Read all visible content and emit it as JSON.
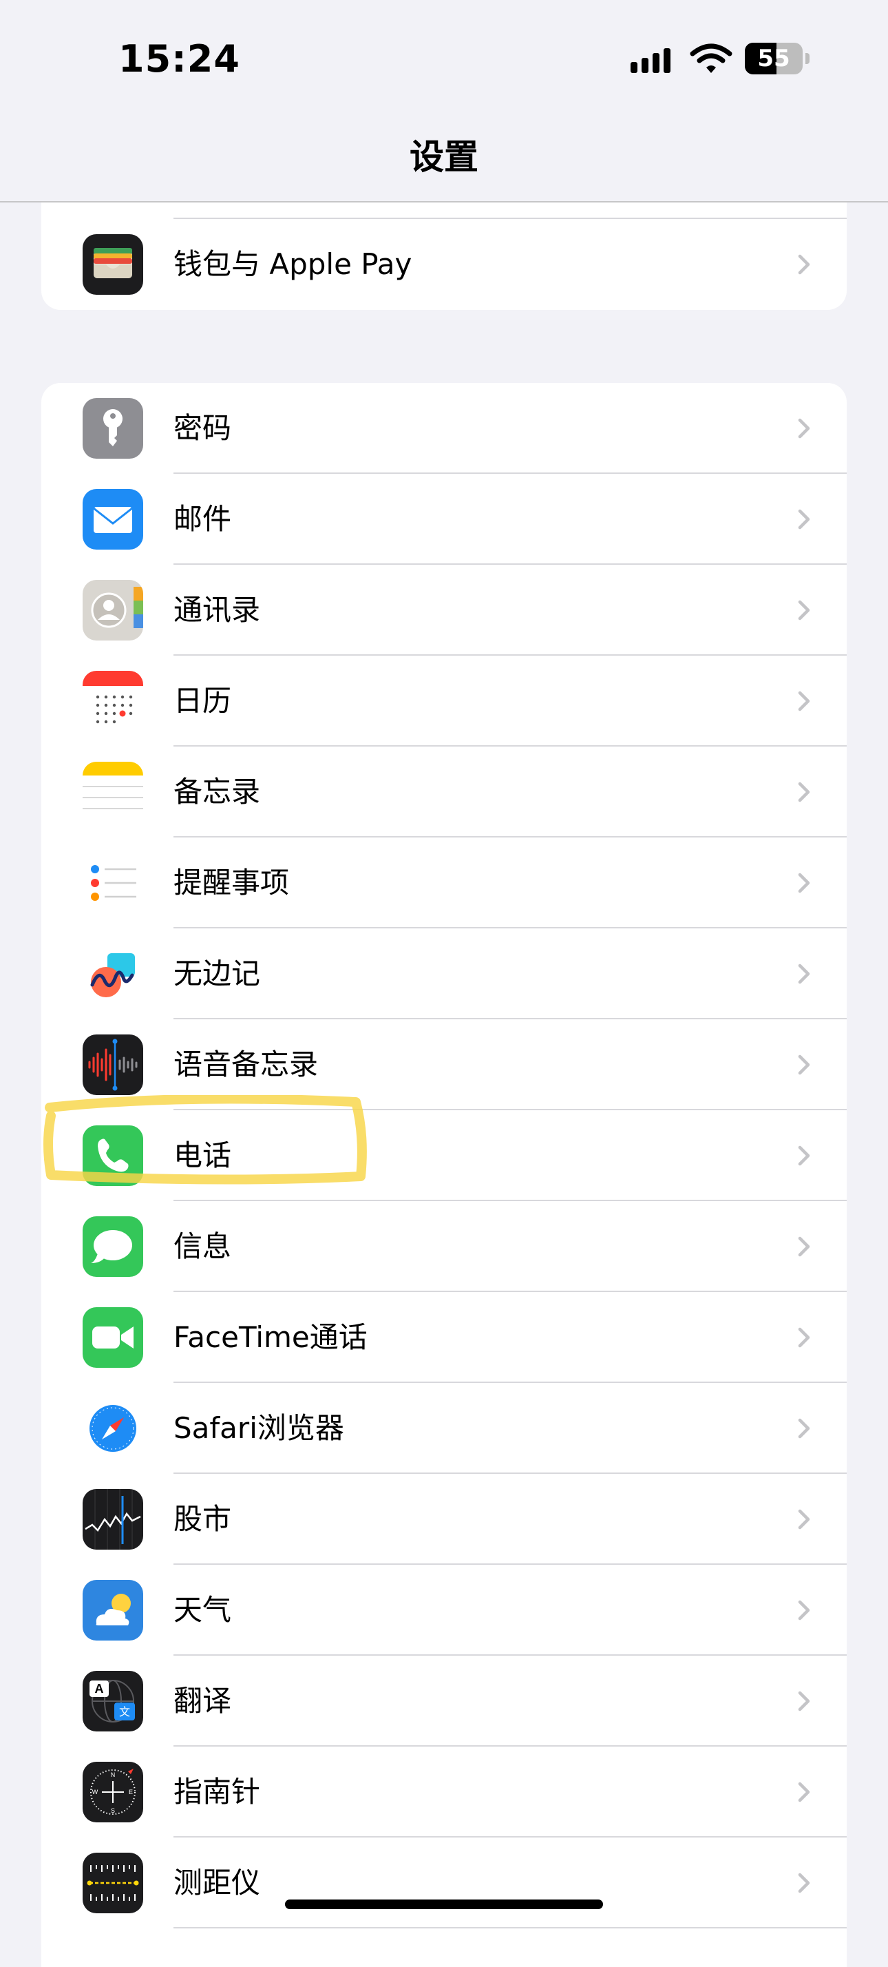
{
  "status_bar": {
    "time": "15:24",
    "battery": "55",
    "battery_level": 0.55
  },
  "nav": {
    "title": "设置"
  },
  "highlight_color": "#F8D548",
  "group_top": [
    {
      "label": "钱包与 Apple Pay",
      "icon": "wallet-icon"
    }
  ],
  "group_main": [
    {
      "label": "密码",
      "icon": "key-icon"
    },
    {
      "label": "邮件",
      "icon": "mail-icon"
    },
    {
      "label": "通讯录",
      "icon": "contacts-icon"
    },
    {
      "label": "日历",
      "icon": "calendar-icon"
    },
    {
      "label": "备忘录",
      "icon": "notes-icon"
    },
    {
      "label": "提醒事项",
      "icon": "reminders-icon"
    },
    {
      "label": "无边记",
      "icon": "freeform-icon"
    },
    {
      "label": "语音备忘录",
      "icon": "voice-memos-icon"
    },
    {
      "label": "电话",
      "icon": "phone-icon"
    },
    {
      "label": "信息",
      "icon": "messages-icon"
    },
    {
      "label": "FaceTime通话",
      "icon": "facetime-icon"
    },
    {
      "label": "Safari浏览器",
      "icon": "safari-icon"
    },
    {
      "label": "股市",
      "icon": "stocks-icon"
    },
    {
      "label": "天气",
      "icon": "weather-icon"
    },
    {
      "label": "翻译",
      "icon": "translate-icon"
    },
    {
      "label": "指南针",
      "icon": "compass-icon"
    },
    {
      "label": "测距仪",
      "icon": "measure-icon"
    }
  ]
}
